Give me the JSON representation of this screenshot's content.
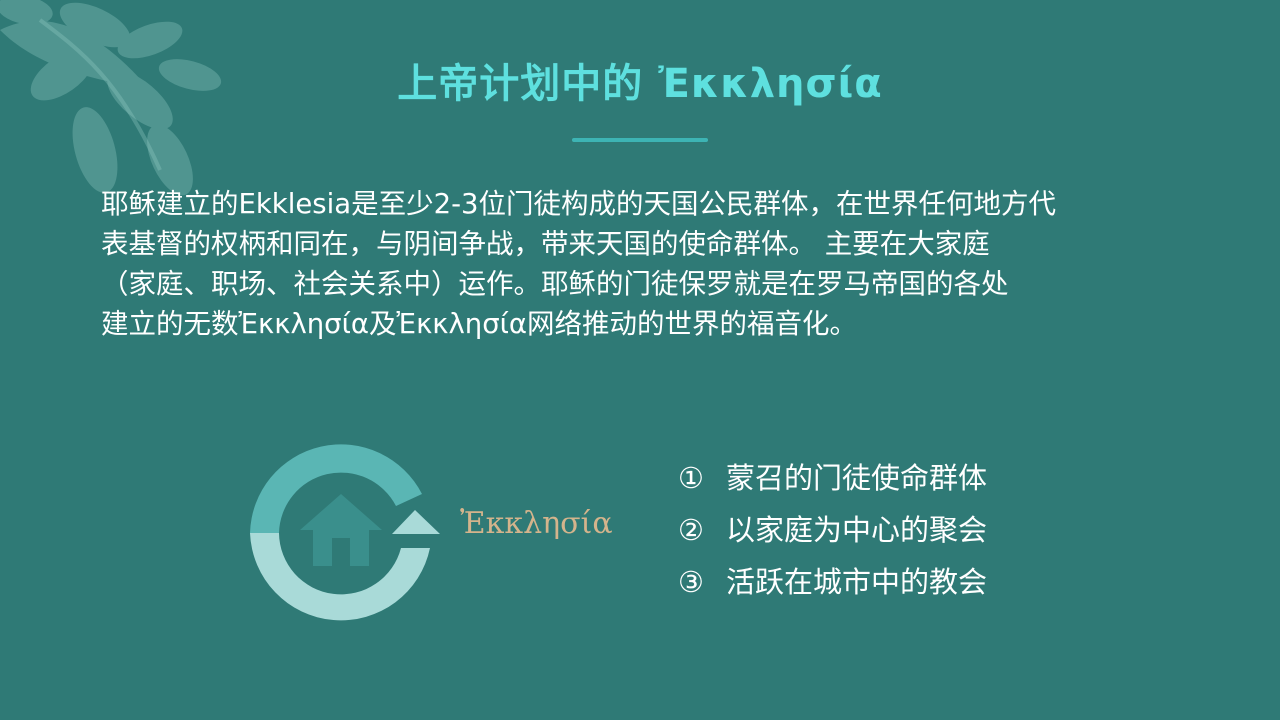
{
  "slide": {
    "title": "上帝计划中的 Ἐκκλησία",
    "body": "耶稣建立的Ekklesia是至少2-3位门徒构成的天国公民群体，在世界任何地方代\n表基督的权柄和同在，与阴间争战，带来天国的使命群体。 主要在大家庭\n（家庭、职场、社会关系中）运作。耶稣的门徒保罗就是在罗马帝国的各处\n建立的无数Ἐκκλησία及Ἐκκλησία网络推动的世界的福音化。",
    "diagram_label": "Ἐκκλησία",
    "points": [
      {
        "num": "①",
        "text": "蒙召的门徒使命群体"
      },
      {
        "num": "②",
        "text": "以家庭为中心的聚会"
      },
      {
        "num": "③",
        "text": "活跃在城市中的教会"
      }
    ]
  },
  "colors": {
    "background": "#2f7a76",
    "title": "#5ee0df",
    "accent_rule": "#3db4b4",
    "label": "#d4b48c",
    "ring_top": "#5ab6b4",
    "ring_bottom": "#a9dad8",
    "house": "#3a8f8c"
  },
  "icons": [
    "leaf-icon",
    "house-icon",
    "cycle-arrow-icon"
  ]
}
